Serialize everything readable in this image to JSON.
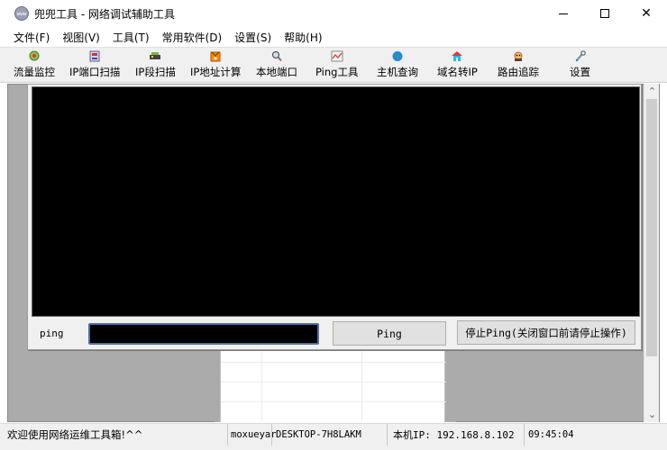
{
  "window": {
    "title": "兜兜工具 - 网络调试辅助工具",
    "app_icon_text": "www",
    "min_icon": "minimize-icon",
    "max_icon": "maximize-icon",
    "close_glyph": "✕"
  },
  "menu": [
    {
      "label": "文件(F)"
    },
    {
      "label": "视图(V)"
    },
    {
      "label": "工具(T)"
    },
    {
      "label": "常用软件(D)"
    },
    {
      "label": "设置(S)"
    },
    {
      "label": "帮助(H)"
    }
  ],
  "toolbar": [
    {
      "label": "流量监控",
      "icon": "traffic-monitor-icon"
    },
    {
      "label": "IP端口扫描",
      "icon": "port-scan-icon"
    },
    {
      "label": "IP段扫描",
      "icon": "segment-scan-icon"
    },
    {
      "label": "IP地址计算",
      "icon": "ip-calc-icon"
    },
    {
      "label": "本地端口",
      "icon": "magnifier-icon"
    },
    {
      "label": "Ping工具",
      "icon": "ping-chart-icon"
    },
    {
      "label": "主机查询",
      "icon": "globe-icon"
    },
    {
      "label": "域名转IP",
      "icon": "house-icon"
    },
    {
      "label": "路由追踪",
      "icon": "router-icon"
    },
    {
      "label": "设置",
      "icon": "settings-icon"
    }
  ],
  "ping_window": {
    "label": "ping",
    "input_value": "",
    "ping_button": "Ping",
    "stop_button": "停止Ping(关闭窗口前请停止操作)"
  },
  "scrollbar": {
    "up": "⌃",
    "down": "⌄"
  },
  "status": {
    "welcome": "欢迎使用网络运维工具箱!^^",
    "user": "moxueyar",
    "host": "DESKTOP-7H8LAKM",
    "ip": "本机IP: 192.168.8.102",
    "time": "09:45:04"
  },
  "colors": {
    "console_bg": "#000000",
    "workspace_bg": "#ababab",
    "toolbar_bg": "#f0f0f0",
    "input_border": "#4f6fa0"
  }
}
